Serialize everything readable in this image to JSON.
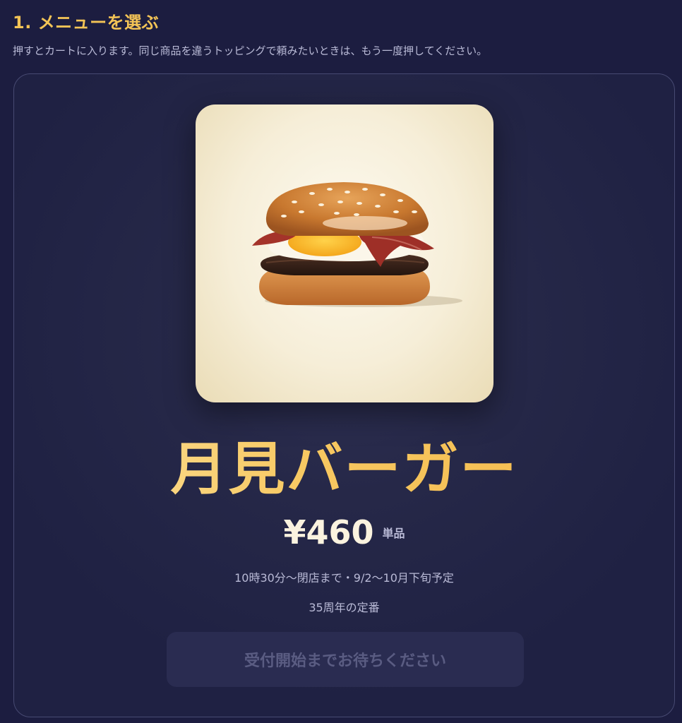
{
  "section": {
    "title": "1. メニューを選ぶ",
    "description": "押すとカートに入ります。同じ商品を違うトッピングで頼みたいときは、もう一度押してください。"
  },
  "menu_item": {
    "name": "月見バーガー",
    "price": "¥460",
    "price_unit": "単品",
    "availability": "10時30分〜閉店まで・9/2〜10月下旬予定",
    "tagline": "35周年の定番",
    "button_label": "受付開始までお待ちください",
    "button_enabled": false
  },
  "colors": {
    "background": "#1c1d40",
    "accent": "#f4c456",
    "muted_text": "#b9bad6",
    "button_disabled_bg": "#2a2c51",
    "button_disabled_text": "#5a5c82"
  }
}
